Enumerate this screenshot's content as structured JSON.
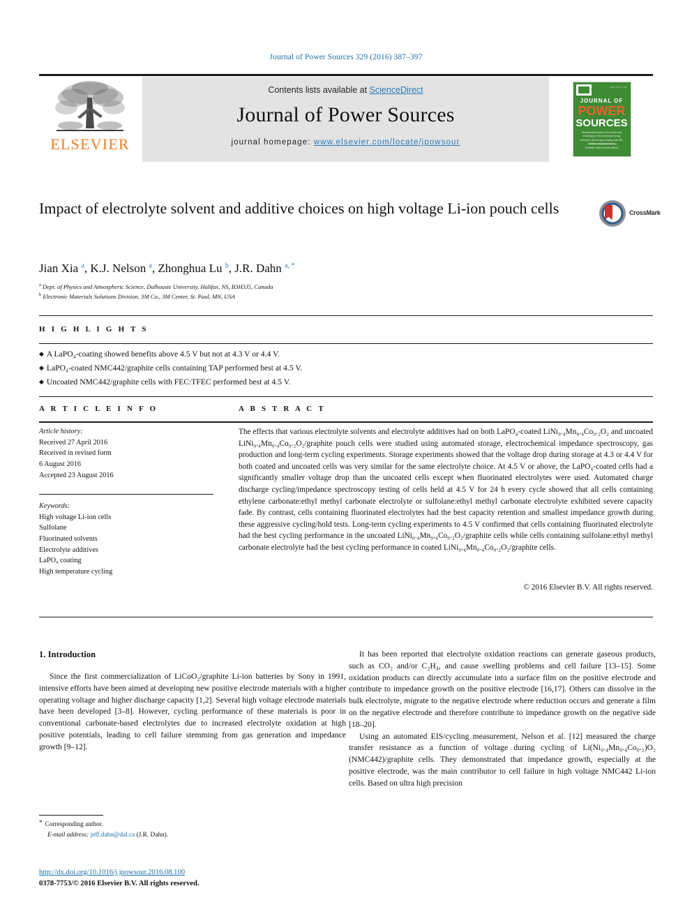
{
  "running_head": "Journal of Power Sources 329 (2016) 387–397",
  "masthead": {
    "contents_prefix": "Contents lists available at ",
    "contents_link": "ScienceDirect",
    "journal_title": "Journal of Power Sources",
    "homepage_prefix": "journal homepage: ",
    "homepage_url": "www.elsevier.com/locate/jpowsour",
    "publisher_logo_text": "ELSEVIER",
    "cover": {
      "line1": "JOURNAL OF",
      "line2": "POWER",
      "line3": "SOURCES",
      "issn": "ISSN 0378-7753",
      "subtitle": "International journal on the science and technology of electrochemical energy conversion and storage including fuel cells, batteries and photovoltaics",
      "editor": "Available online at ScienceDirect"
    }
  },
  "article": {
    "title": "Impact of electrolyte solvent and additive choices on high voltage Li-ion pouch cells",
    "authors": [
      {
        "name": "Jian Xia",
        "marks": "a"
      },
      {
        "name": "K.J. Nelson",
        "marks": "a"
      },
      {
        "name": "Zhonghua Lu",
        "marks": "b"
      },
      {
        "name": "J.R. Dahn",
        "marks": "a, *"
      }
    ],
    "affiliations": [
      {
        "mark": "a",
        "text": "Dept. of Physics and Atmospheric Science, Dalhousie University, Halifax, NS, B3H3J5, Canada"
      },
      {
        "mark": "b",
        "text": "Electronic Materials Solutions Division, 3M Co., 3M Center, St. Paul, MN, USA"
      }
    ],
    "crossmark_label": "CrossMark"
  },
  "highlights": {
    "heading": "H I G H L I G H T S",
    "items": [
      "A LaPO₄-coating showed benefits above 4.5 V but not at 4.3 V or 4.4 V.",
      "LaPO₄-coated NMC442/graphite cells containing TAP performed best at 4.5 V.",
      "Uncoated NMC442/graphite cells with FEC:TFEC performed best at 4.5 V."
    ]
  },
  "article_info": {
    "heading": "A R T I C L E  I N F O",
    "history_label": "Article history:",
    "history": [
      "Received 27 April 2016",
      "Received in revised form",
      "6 August 2016",
      "Accepted 23 August 2016"
    ],
    "keywords_label": "Keywords:",
    "keywords": [
      "High voltage Li-ion cells",
      "Sulfolane",
      "Fluorinated solvents",
      "Electrolyte additives",
      "LaPO₄ coating",
      "High temperature cycling"
    ]
  },
  "abstract": {
    "heading": "A B S T R A C T",
    "text": "The effects that various electrolyte solvents and electrolyte additives had on both LaPO₄-coated LiNi₀.₄Mn₀.₄Co₀.₂O₂ and uncoated LiNi₀.₄Mn₀.₄Co₀.₂O₂/graphite pouch cells were studied using automated storage, electrochemical impedance spectroscopy, gas production and long-term cycling experiments. Storage experiments showed that the voltage drop during storage at 4.3 or 4.4 V for both coated and uncoated cells was very similar for the same electrolyte choice. At 4.5 V or above, the LaPO₄-coated cells had a significantly smaller voltage drop than the uncoated cells except when fluorinated electrolytes were used. Automated charge discharge cycling/impedance spectroscopy testing of cells held at 4.5 V for 24 h every cycle showed that all cells containing ethylene carbonate:ethyl methyl carbonate electrolyte or sulfolane:ethyl methyl carbonate electrolyte exhibited severe capacity fade. By contrast, cells containing fluorinated electrolytes had the best capacity retention and smallest impedance growth during these aggressive cycling/hold tests. Long-term cycling experiments to 4.5 V confirmed that cells containing fluorinated electrolyte had the best cycling performance in the uncoated LiNi₀.₄Mn₀.₄Co₀.₂O₂/graphite cells while cells containing sulfolane:ethyl methyl carbonate electrolyte had the best cycling performance in coated LiNi₀.₄Mn₀.₄Co₀.₂O₂/graphite cells.",
    "copyright": "© 2016 Elsevier B.V. All rights reserved."
  },
  "body": {
    "section_number_title": "1. Introduction",
    "left_paragraph_1": "Since the first commercialization of LiCoO₂/graphite Li-ion batteries by Sony in 1991, intensive efforts have been aimed at developing new positive electrode materials with a higher operating voltage and higher discharge capacity [1,2]. Several high voltage electrode materials have been developed [3–8]. However, cycling performance of these materials is poor in conventional carbonate-based electrolytes due to increased electrolyte oxidation at high positive potentials, leading to cell failure stemming from gas generation and impedance growth [9–12].",
    "right_paragraph_1": "It has been reported that electrolyte oxidation reactions can generate gaseous products, such as CO₂ and/or C₂H₄, and cause swelling problems and cell failure [13–15]. Some oxidation products can directly accumulate into a surface film on the positive electrode and contribute to impedance growth on the positive electrode [16,17]. Others can dissolve in the bulk electrolyte, migrate to the negative electrode where reduction occurs and generate a film on the negative electrode and therefore contribute to impedance growth on the negative side [18–20].",
    "right_paragraph_2": "Using an automated EIS/cycling measurement, Nelson et al. [12] measured the charge transfer resistance as a function of voltage during cycling of Li(Ni₀.₄Mn₀.₄Co₀.₂)O₂ (NMC442)/graphite cells. They demonstrated that impedance growth, especially at the positive electrode, was the main contributor to cell failure in high voltage NMC442 Li-ion cells. Based on ultra high precision"
  },
  "footer": {
    "corresponding_author": "Corresponding author.",
    "email_label": "E-mail address:",
    "email": "jeff.dahn@dal.ca",
    "email_owner": "(J.R. Dahn).",
    "doi_url": "http://dx.doi.org/10.1016/j.jpowsour.2016.08.100",
    "issn_line": "0378-7753/© 2016 Elsevier B.V. All rights reserved."
  },
  "colors": {
    "link": "#1a6fa8",
    "elsevier_orange": "#ef7d22",
    "cover_green": "#3f8b35",
    "crossmark_red": "#c8352b"
  }
}
